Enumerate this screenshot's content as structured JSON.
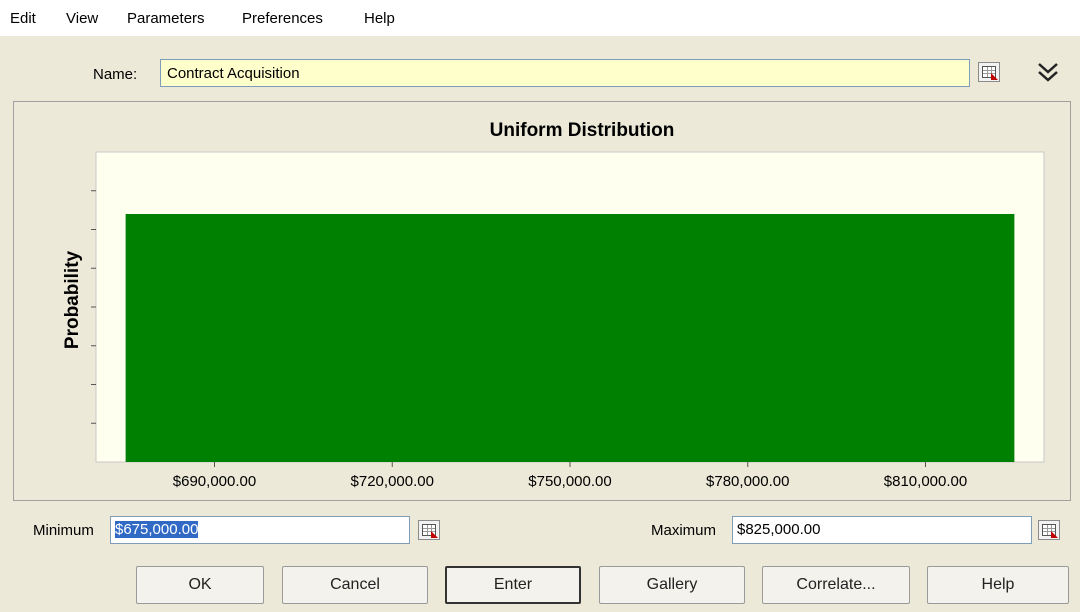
{
  "menu": [
    "Edit",
    "View",
    "Parameters",
    "Preferences",
    "Help"
  ],
  "name_field": {
    "label": "Name:",
    "value": "Contract Acquisition"
  },
  "chart_data": {
    "type": "area",
    "title": "Uniform Distribution",
    "ylabel": "Probability",
    "xlabel": "",
    "x_ticks": [
      "$690,000.00",
      "$720,000.00",
      "$750,000.00",
      "$780,000.00",
      "$810,000.00"
    ],
    "x_tick_values": [
      690000,
      720000,
      750000,
      780000,
      810000
    ],
    "xlim": [
      670000,
      830000
    ],
    "distribution": {
      "min": 675000,
      "max": 825000
    },
    "y_tick_count": 7,
    "bar_color": "#008000",
    "plot_background": "#fffff0"
  },
  "minimum": {
    "label": "Minimum",
    "value": "$675,000.00"
  },
  "maximum": {
    "label": "Maximum",
    "value": "$825,000.00"
  },
  "buttons": {
    "ok": "OK",
    "cancel": "Cancel",
    "enter": "Enter",
    "gallery": "Gallery",
    "correlate": "Correlate...",
    "help": "Help"
  },
  "icons": {
    "cell_reference": "cell-reference-icon",
    "expand": "double-chevron-down-icon"
  }
}
